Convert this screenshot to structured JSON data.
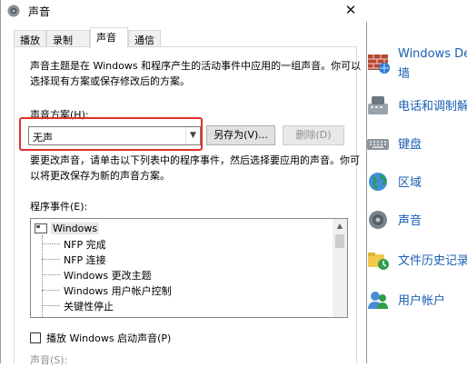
{
  "window": {
    "title": "声音",
    "close_glyph": "✕"
  },
  "tabs": [
    {
      "label": "播放"
    },
    {
      "label": "录制"
    },
    {
      "label": "声音"
    },
    {
      "label": "通信"
    }
  ],
  "description": {
    "line1": "声音主题是在 Windows 和程序产生的活动事件中应用的一组声音。你可以",
    "line2": "选择现有方案或保存修改后的方案。"
  },
  "scheme": {
    "label": "声音方案(H):",
    "selected": "无声",
    "save_as_button": "另存为(V)...",
    "delete_button": "删除(D)"
  },
  "instructions": {
    "line1": "要更改声音，请单击以下列表中的程序事件，然后选择要应用的声音。你可",
    "line2": "以将更改保存为新的声音方案。"
  },
  "events": {
    "label": "程序事件(E):",
    "root": "Windows",
    "items": [
      "NFP 完成",
      "NFP 连接",
      "Windows 更改主题",
      "Windows 用户帐户控制",
      "关键性停止"
    ]
  },
  "startup": {
    "checkbox_label": "播放 Windows 启动声音(P)",
    "checked": false
  },
  "sound_field_label": "声音(S):",
  "control_panel": {
    "items": [
      {
        "line1": "Windows De",
        "line2": "墙",
        "icon": "firewall-icon"
      },
      {
        "line1": "电话和调制解",
        "icon": "phone-modem-icon"
      },
      {
        "line1": "键盘",
        "icon": "keyboard-icon"
      },
      {
        "line1": "区域",
        "icon": "region-globe-icon"
      },
      {
        "line1": "声音",
        "icon": "speaker-icon"
      },
      {
        "line1": "文件历史记录",
        "icon": "file-history-icon"
      },
      {
        "line1": "用户帐户",
        "icon": "user-accounts-icon"
      }
    ]
  },
  "colors": {
    "highlight_border": "#e0312a",
    "link_blue": "#1a5fb4"
  }
}
